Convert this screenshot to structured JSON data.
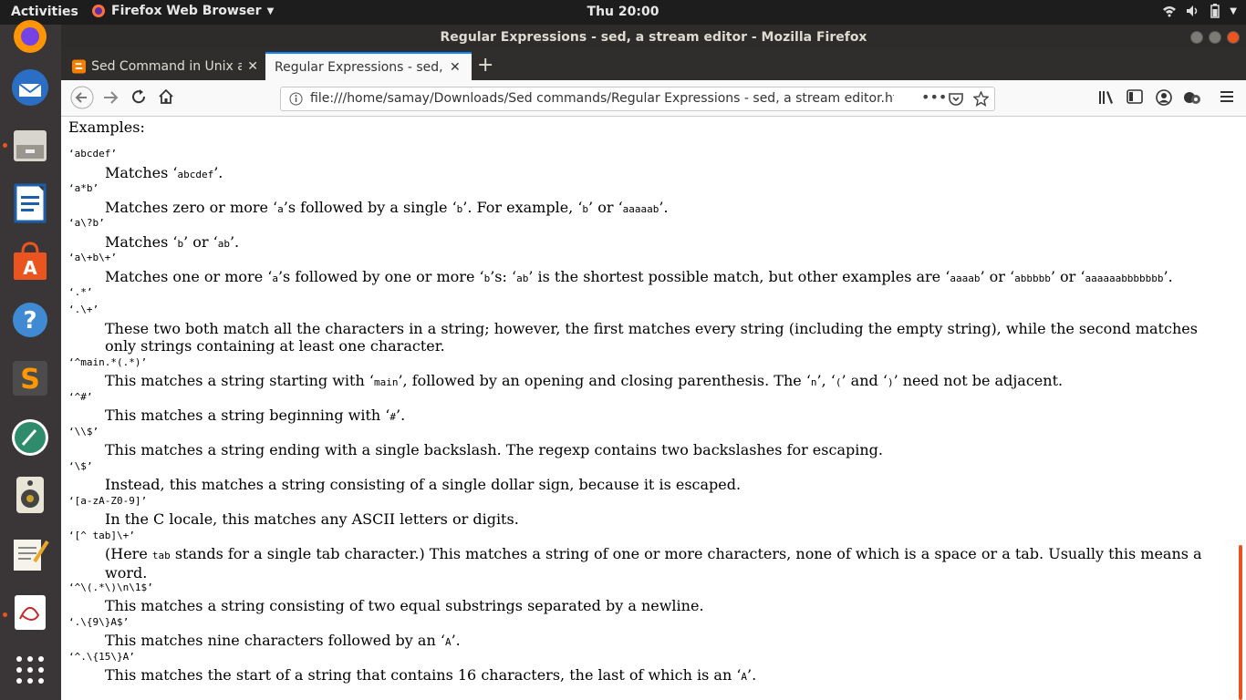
{
  "topbar": {
    "activities": "Activities",
    "app_name": "Firefox Web Browser",
    "clock": "Thu 20:00"
  },
  "window": {
    "title": "Regular Expressions - sed, a stream editor - Mozilla Firefox"
  },
  "tabs": [
    {
      "label": "Sed Command in Unix an"
    },
    {
      "label": "Regular Expressions - sed, a"
    }
  ],
  "url": {
    "value": "file:///home/samay/Downloads/Sed commands/Regular Expressions - sed, a stream editor.htm"
  },
  "content": {
    "heading": "Examples:",
    "entries": [
      {
        "term": "‘abcdef’",
        "desc": [
          "Matches ‘",
          "abcdef",
          "’."
        ]
      },
      {
        "term": "‘a*b’",
        "desc": [
          "Matches zero or more ‘",
          "a",
          "’s followed by a single ‘",
          "b",
          "’. For example, ‘",
          "b",
          "’ or ‘",
          "aaaaab",
          "’."
        ]
      },
      {
        "term": "‘a\\?b’",
        "desc": [
          "Matches ‘",
          "b",
          "’ or ‘",
          "ab",
          "’."
        ]
      },
      {
        "term": "‘a\\+b\\+’",
        "desc": [
          "Matches one or more ‘",
          "a",
          "’s followed by one or more ‘",
          "b",
          "’s: ‘",
          "ab",
          "’ is the shortest possible match, but other examples are ‘",
          "aaaab",
          "’ or ‘",
          "abbbbb",
          "’ or ‘",
          "aaaaaabbbbbbb",
          "’."
        ]
      },
      {
        "term": "‘.*’",
        "desc": []
      },
      {
        "term": "‘.\\+’",
        "desc": [
          "These two both match all the characters in a string; however, the first matches every string (including the empty string), while the second matches only strings containing at least one character."
        ]
      },
      {
        "term": "‘^main.*(.*)’",
        "desc": [
          "This matches a string starting with ‘",
          "main",
          "’, followed by an opening and closing parenthesis. The ‘",
          "n",
          "’, ‘",
          "(",
          "’ and ‘",
          ")",
          "’ need not be adjacent."
        ]
      },
      {
        "term": "‘^#’",
        "desc": [
          "This matches a string beginning with ‘",
          "#",
          "’."
        ]
      },
      {
        "term": "‘\\\\$’",
        "desc": [
          "This matches a string ending with a single backslash. The regexp contains two backslashes for escaping."
        ]
      },
      {
        "term": "‘\\$’",
        "desc": [
          "Instead, this matches a string consisting of a single dollar sign, because it is escaped."
        ]
      },
      {
        "term": "‘[a-zA-Z0-9]’",
        "desc": [
          "In the C locale, this matches any ASCII letters or digits."
        ]
      },
      {
        "term": "‘[^ tab]\\+’",
        "desc": [
          "(Here ",
          "tab",
          " stands for a single tab character.) This matches a string of one or more characters, none of which is a space or a tab. Usually this means a word."
        ]
      },
      {
        "term": "‘^\\(.*\\)\\n\\1$’",
        "desc": [
          "This matches a string consisting of two equal substrings separated by a newline."
        ]
      },
      {
        "term": "‘.\\{9\\}A$’",
        "desc": [
          "This matches nine characters followed by an ‘",
          "A",
          "’."
        ]
      },
      {
        "term": "‘^.\\{15\\}A’",
        "desc": [
          "This matches the start of a string that contains 16 characters, the last of which is an ‘",
          "A",
          "’."
        ]
      }
    ]
  },
  "colors": {
    "accent": "#e9541f",
    "tab_highlight": "#0a84ff",
    "dock": "#3a3637"
  }
}
